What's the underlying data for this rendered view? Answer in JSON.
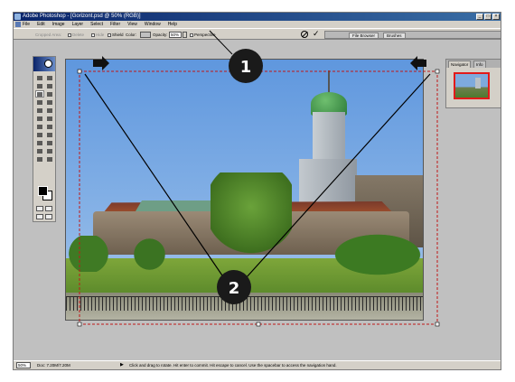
{
  "window": {
    "title": "Adobe Photoshop - [Gorizont.psd @ 50% (RGB)]",
    "buttons": {
      "minimize": "_",
      "maximize": "□",
      "close": "×"
    }
  },
  "menubar": {
    "items": [
      {
        "label": "File"
      },
      {
        "label": "Edit"
      },
      {
        "label": "Image"
      },
      {
        "label": "Layer"
      },
      {
        "label": "Select"
      },
      {
        "label": "Filter"
      },
      {
        "label": "View"
      },
      {
        "label": "Window"
      },
      {
        "label": "Help"
      }
    ]
  },
  "options_bar": {
    "cropped_area_label": "Cropped Area:",
    "delete_label": "Delete",
    "hide_label": "Hide",
    "shield_label": "Shield",
    "color_label": "Color:",
    "opacity_label": "Opacity:",
    "opacity_value": "50%",
    "perspective_label": "Perspective",
    "cancel_icon": "cancel-icon",
    "commit_icon": "checkmark-icon",
    "commit_glyph": "✓"
  },
  "palette_well": {
    "tabs": [
      {
        "label": "File Browser"
      },
      {
        "label": "Brushes"
      }
    ]
  },
  "navigator": {
    "tabs": [
      {
        "label": "Navigator"
      },
      {
        "label": "Info"
      }
    ]
  },
  "callouts": [
    {
      "number": "1"
    },
    {
      "number": "2"
    }
  ],
  "statusbar": {
    "zoom": "50%",
    "doc_info": "Doc: 7.20M/7.20M",
    "arrow": "▶",
    "hint": "Click and drag to rotate. Hit enter to commit. Hit escape to cancel. Use the spacebar to access the navigation hand."
  },
  "colors": {
    "titlebar": "#0a246a",
    "crop_marquee": "#c01818",
    "callout_fill": "#1a1a1a",
    "callout_text": "#ffffff"
  }
}
